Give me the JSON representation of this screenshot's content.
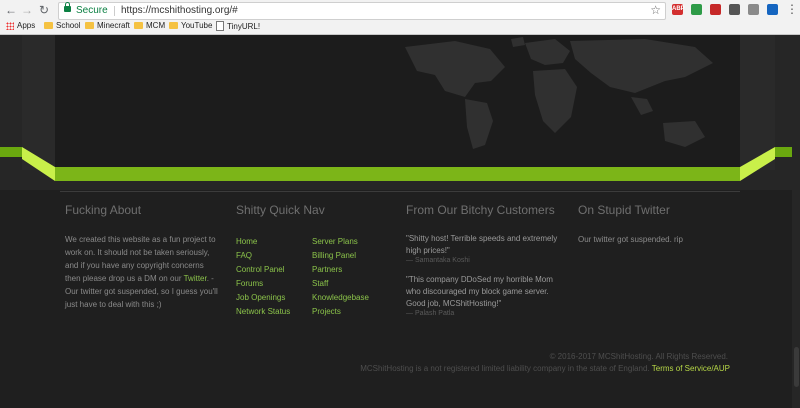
{
  "browser": {
    "secure_label": "Secure",
    "url": "https://mcshithosting.org/#",
    "bookmarks": [
      {
        "label": "Apps",
        "icon": "apps-grid-icon"
      },
      {
        "label": "School",
        "icon": "folder-icon"
      },
      {
        "label": "Minecraft",
        "icon": "folder-icon"
      },
      {
        "label": "MCM",
        "icon": "folder-icon"
      },
      {
        "label": "YouTube",
        "icon": "folder-icon"
      },
      {
        "label": "TinyURL!",
        "icon": "page-icon"
      }
    ],
    "extensions": [
      {
        "name": "abp-icon",
        "color": "#d32f2f",
        "text": "ABP"
      },
      {
        "name": "green-circle-icon",
        "color": "#2e9b48",
        "text": ""
      },
      {
        "name": "red-square-icon",
        "color": "#c62828",
        "text": ""
      },
      {
        "name": "dark-square-icon",
        "color": "#555555",
        "text": ""
      },
      {
        "name": "grey-square-icon",
        "color": "#8a8a8a",
        "text": ""
      },
      {
        "name": "blue-square-icon",
        "color": "#1565c0",
        "text": ""
      }
    ]
  },
  "footer": {
    "about": {
      "title": "Fucking About",
      "text_before": "We created this website as a fun project to work on. It should not be taken seriously, and if you have any copyright concerns then please drop us a DM on our ",
      "link": "Twitter",
      "text_after": ". - Our twitter got suspended, so I guess you'll just have to deal with this ;)"
    },
    "nav": {
      "title": "Shitty Quick Nav",
      "left": [
        "Home",
        "FAQ",
        "Control Panel",
        "Forums",
        "Job Openings",
        "Network Status"
      ],
      "right": [
        "Server Plans",
        "Billing Panel",
        "Partners",
        "Staff",
        "Knowledgebase",
        "Projects"
      ]
    },
    "customers": {
      "title": "From Our Bitchy Customers",
      "quotes": [
        {
          "text": "\"Shitty host! Terrible speeds and extremely high prices!\"",
          "author": "— Samantaka Koshi"
        },
        {
          "text": "\"This company DDoSed my horrible Mom who discouraged my block game server. Good job, MCShitHosting!\"",
          "author": "— Palash Patla"
        }
      ]
    },
    "twitter": {
      "title": "On Stupid Twitter",
      "text": "Our twitter got suspended. rip"
    },
    "copyright": "© 2016-2017 MCShitHosting. All Rights Reserved.",
    "legal_text": "MCShitHosting is a not registered limited liability company in the state of England.",
    "tos_link": "Terms of Service/AUP"
  },
  "colors": {
    "accent_green": "#8bc34a",
    "band_green": "#7cb518",
    "background": "#1f1f1f"
  }
}
